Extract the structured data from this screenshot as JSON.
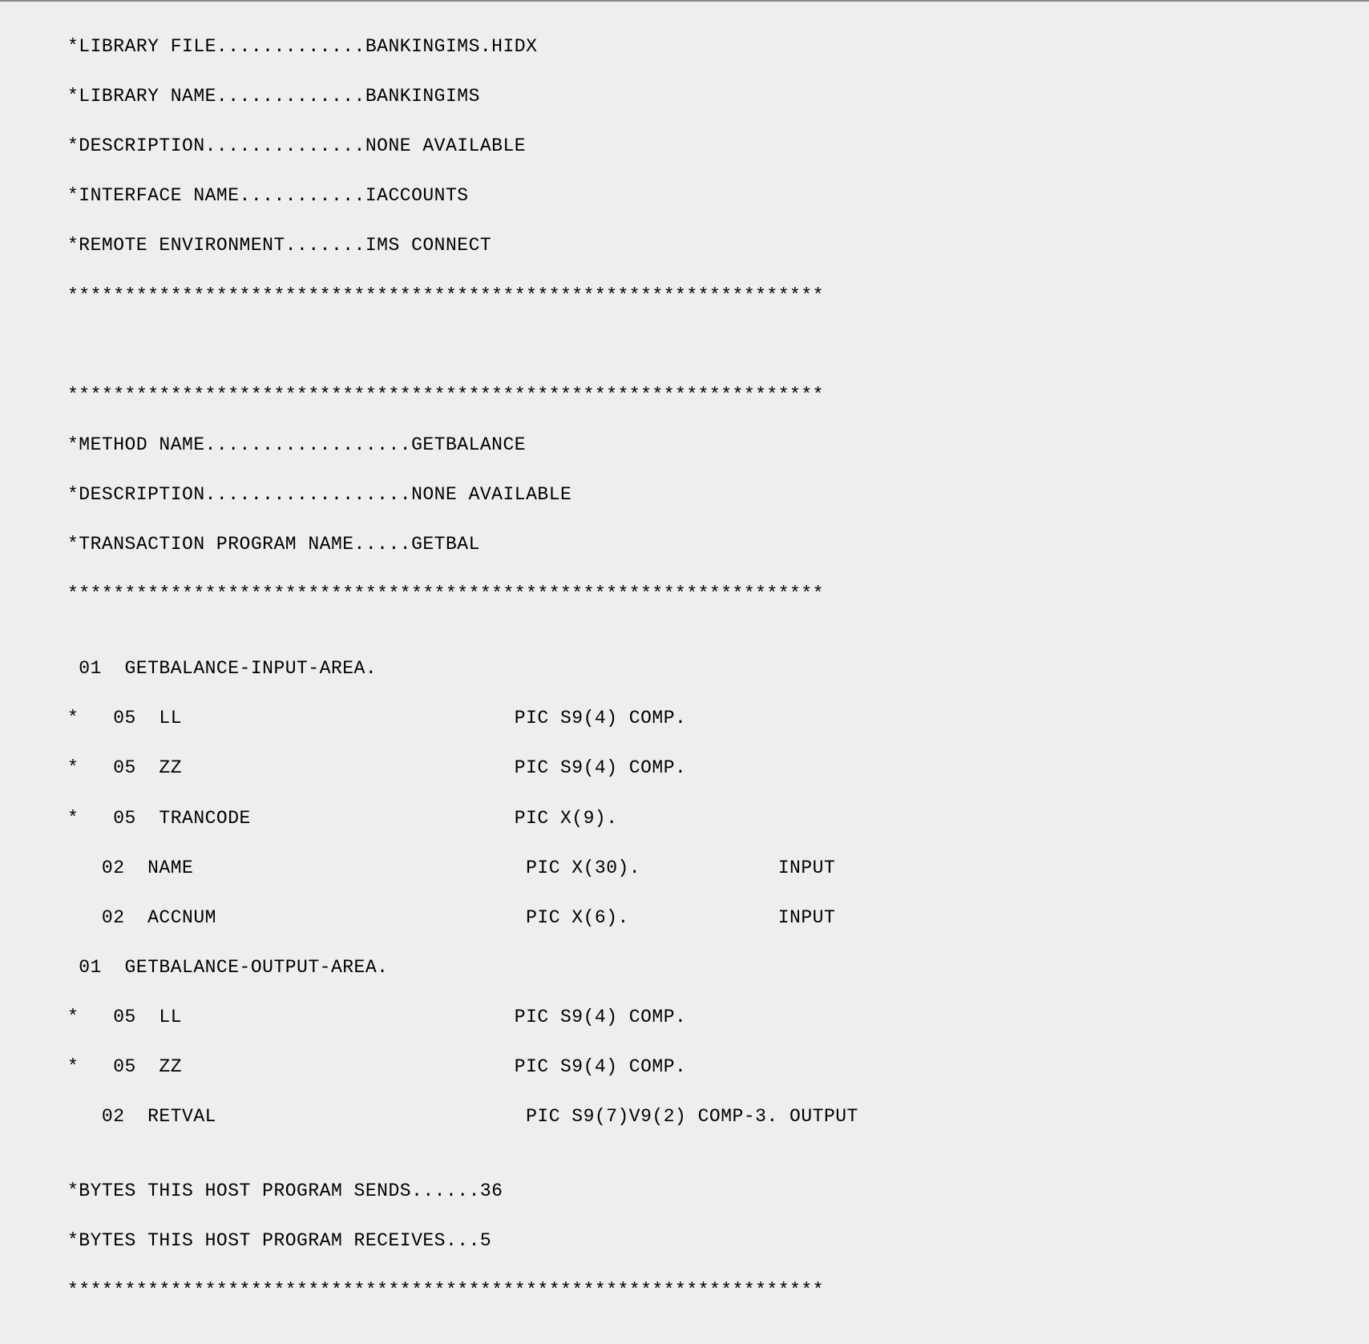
{
  "lines": {
    "l01": "*LIBRARY FILE.............BANKINGIMS.HIDX",
    "l02": "*LIBRARY NAME.............BANKINGIMS",
    "l03": "*DESCRIPTION..............NONE AVAILABLE",
    "l04": "*INTERFACE NAME...........IACCOUNTS",
    "l05": "*REMOTE ENVIRONMENT.......IMS CONNECT",
    "l06": "******************************************************************",
    "l07": "",
    "l08": "",
    "l09": "******************************************************************",
    "l10": "*METHOD NAME..................GETBALANCE",
    "l11": "*DESCRIPTION..................NONE AVAILABLE",
    "l12": "*TRANSACTION PROGRAM NAME.....GETBAL",
    "l13": "******************************************************************",
    "l14": "",
    "l15": " 01  GETBALANCE-INPUT-AREA.",
    "l16": "*   05  LL                             PIC S9(4) COMP.",
    "l17": "*   05  ZZ                             PIC S9(4) COMP.",
    "l18": "*   05  TRANCODE                       PIC X(9).",
    "l19": "   02  NAME                             PIC X(30).            INPUT",
    "l20": "   02  ACCNUM                           PIC X(6).             INPUT",
    "l21": " 01  GETBALANCE-OUTPUT-AREA.",
    "l22": "*   05  LL                             PIC S9(4) COMP.",
    "l23": "*   05  ZZ                             PIC S9(4) COMP.",
    "l24": "   02  RETVAL                           PIC S9(7)V9(2) COMP-3. OUTPUT",
    "l25": "",
    "l26": "*BYTES THIS HOST PROGRAM SENDS......36",
    "l27": "*BYTES THIS HOST PROGRAM RECEIVES...5",
    "l28": "******************************************************************"
  }
}
